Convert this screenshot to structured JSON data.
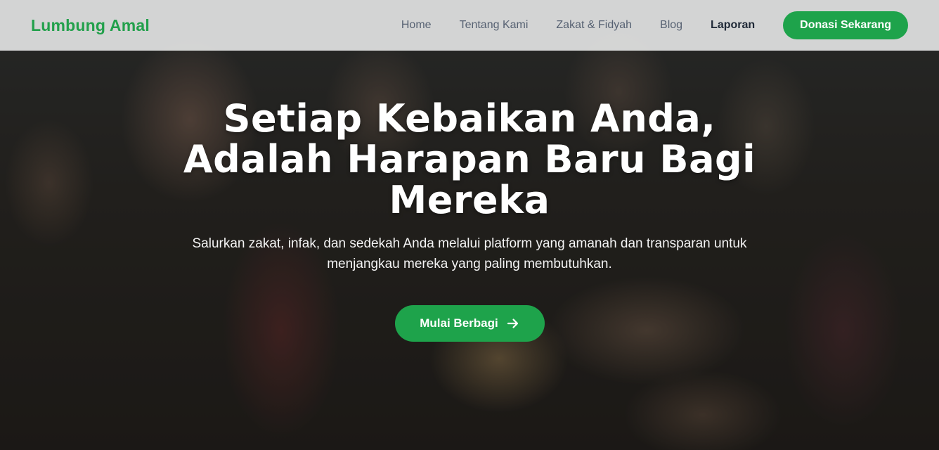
{
  "brand": {
    "name": "Lumbung Amal",
    "color": "#22a04b"
  },
  "nav": {
    "items": [
      {
        "label": "Home"
      },
      {
        "label": "Tentang Kami"
      },
      {
        "label": "Zakat & Fidyah"
      },
      {
        "label": "Blog"
      },
      {
        "label": "Laporan",
        "active": true
      }
    ],
    "cta_label": "Donasi Sekarang"
  },
  "hero": {
    "title": "Setiap Kebaikan Anda, Adalah Harapan Baru Bagi Mereka",
    "subtitle": "Salurkan zakat, infak, dan sedekah Anda melalui platform yang amanah dan transparan untuk menjangkau mereka yang paling membutuhkan.",
    "cta_label": "Mulai Berbagi",
    "cta_icon": "arrow-right-icon"
  },
  "colors": {
    "accent": "#1ea34b",
    "header_bg": "#ecedeD",
    "nav_text": "#566172",
    "nav_active": "#1f2937"
  }
}
